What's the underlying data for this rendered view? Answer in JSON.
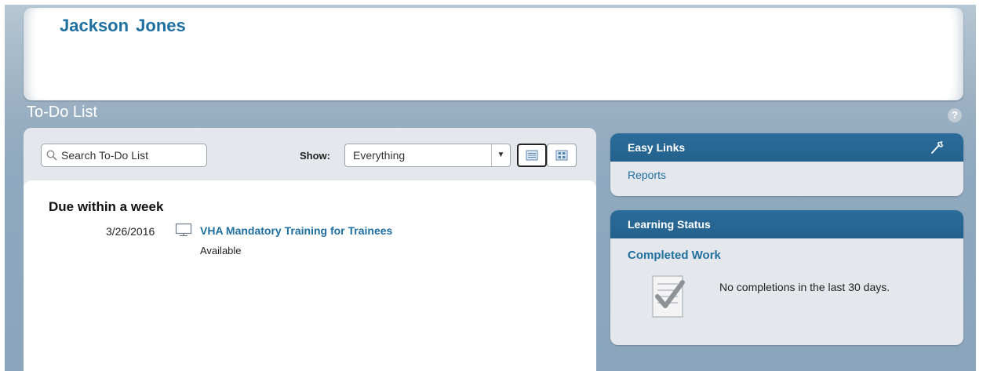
{
  "header": {
    "user_name": "Jackson  Jones"
  },
  "section": {
    "title": "To-Do List",
    "help_label": "?"
  },
  "toolbar": {
    "search_placeholder": "Search To-Do List",
    "show_label": "Show:",
    "show_selected": "Everything"
  },
  "todo": {
    "group_heading": "Due within a week",
    "items": [
      {
        "date": "3/26/2016",
        "title": "VHA Mandatory Training for Trainees",
        "status": "Available",
        "icon": "monitor-icon"
      }
    ]
  },
  "easy_links": {
    "title": "Easy Links",
    "links": [
      "Reports"
    ]
  },
  "learning_status": {
    "title": "Learning Status",
    "subheading": "Completed Work",
    "message": "No completions in the last 30 days."
  },
  "colors": {
    "accent_link": "#1f6f9f",
    "widget_header": "#24618d",
    "page_bg": "#8aa5bc"
  }
}
